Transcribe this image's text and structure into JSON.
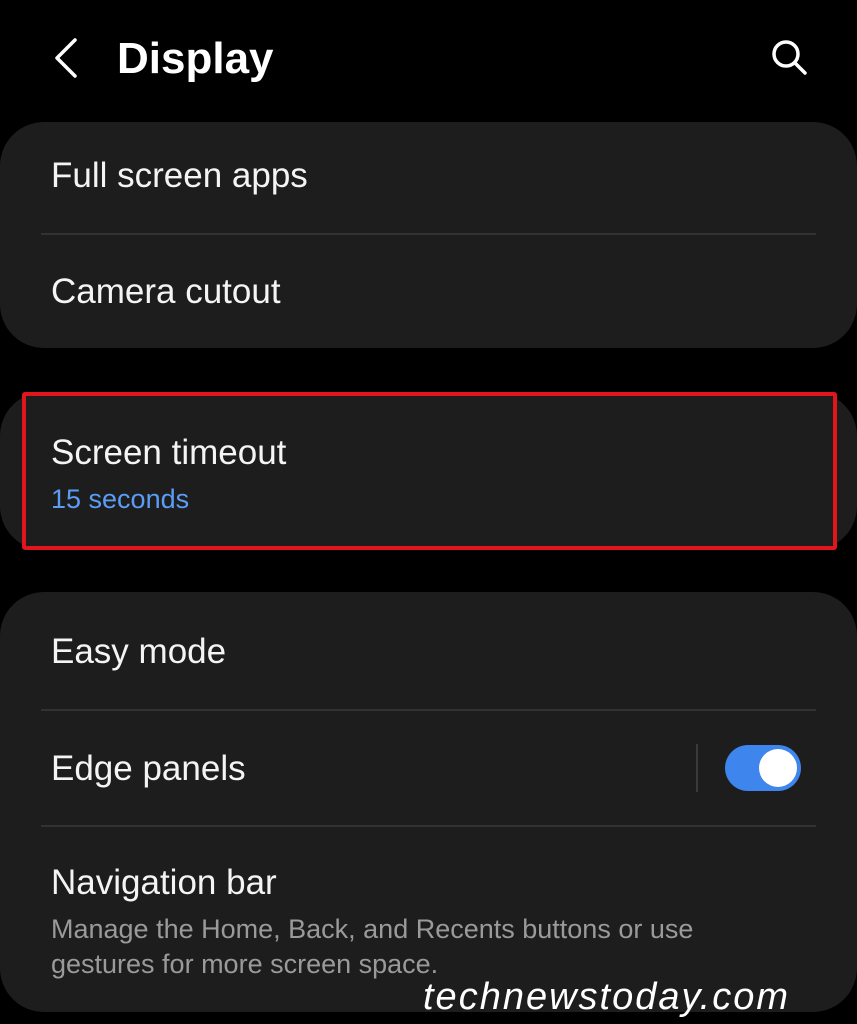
{
  "header": {
    "title": "Display",
    "back_icon": "chevron-left-icon",
    "search_icon": "search-icon"
  },
  "groups": [
    {
      "items": [
        {
          "title": "Full screen apps"
        },
        {
          "title": "Camera cutout"
        }
      ]
    },
    {
      "items": [
        {
          "title": "Screen timeout",
          "value": "15 seconds",
          "highlighted": true
        }
      ]
    },
    {
      "items": [
        {
          "title": "Easy mode"
        },
        {
          "title": "Edge panels",
          "toggle": true
        },
        {
          "title": "Navigation bar",
          "description": "Manage the Home, Back, and Recents buttons or use gestures for more screen space."
        }
      ]
    }
  ],
  "watermark": "technewstoday.com",
  "colors": {
    "background": "#000000",
    "card": "#1d1d1d",
    "accent": "#5b9df5",
    "toggle_on": "#3e86ee",
    "highlight_border": "#e0161c"
  }
}
